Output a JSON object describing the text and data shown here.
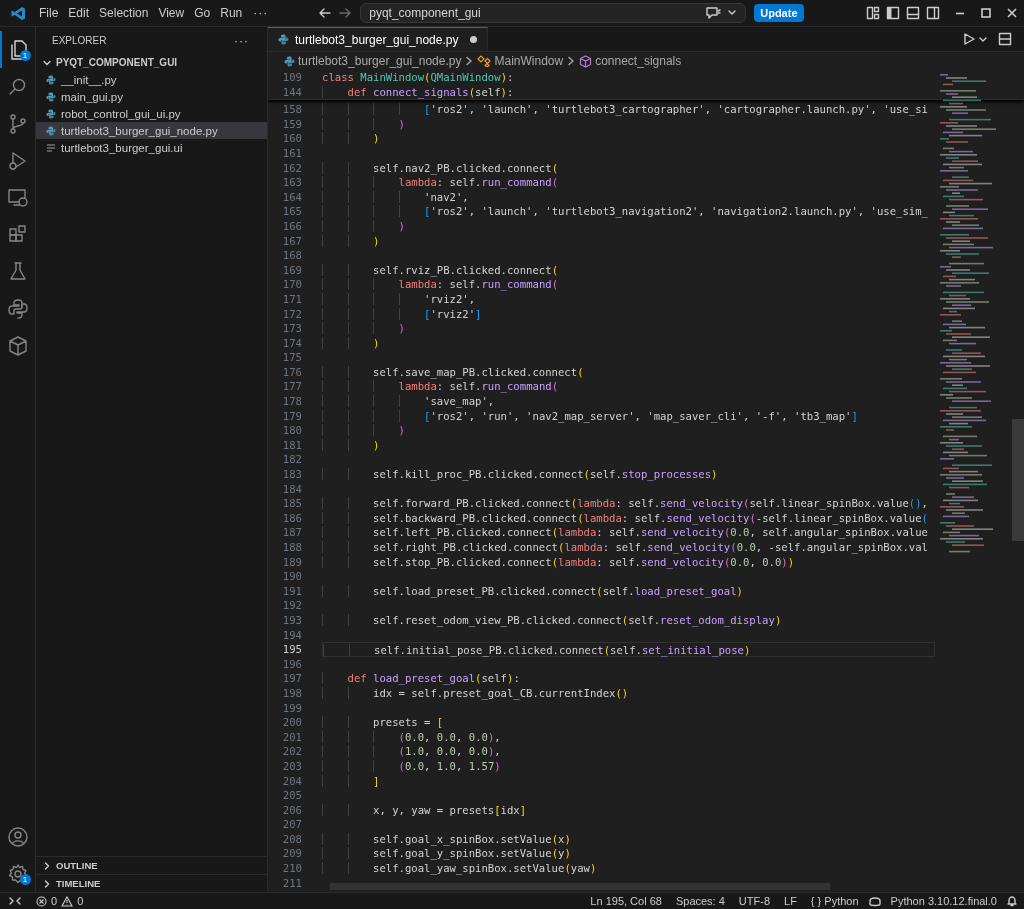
{
  "title_bar": {
    "menus": [
      "File",
      "Edit",
      "Selection",
      "View",
      "Go",
      "Run"
    ],
    "overflow": "···",
    "search": "pyqt_component_gui",
    "update_button": "Update"
  },
  "activity_bar": {
    "items": [
      {
        "kind": "explorer",
        "selected": true,
        "badge": "1"
      },
      {
        "kind": "search",
        "selected": false
      },
      {
        "kind": "source-control",
        "selected": false
      },
      {
        "kind": "run-debug",
        "selected": false
      },
      {
        "kind": "remote",
        "selected": false
      },
      {
        "kind": "extensions",
        "selected": false
      },
      {
        "kind": "testing",
        "selected": false
      },
      {
        "kind": "python",
        "selected": false
      },
      {
        "kind": "containers",
        "selected": false
      }
    ],
    "bottom": [
      {
        "kind": "account"
      },
      {
        "kind": "settings",
        "badge": "1"
      }
    ]
  },
  "sidebar": {
    "title": "EXPLORER",
    "more": "···",
    "folder": {
      "name": "PYQT_COMPONENT_GUI",
      "expanded": true,
      "children": [
        {
          "name": "__init__.py",
          "kind": "python",
          "selected": false
        },
        {
          "name": "main_gui.py",
          "kind": "python",
          "selected": false
        },
        {
          "name": "robot_control_gui_ui.py",
          "kind": "python",
          "selected": false
        },
        {
          "name": "turtlebot3_burger_gui_node.py",
          "kind": "python",
          "selected": true
        },
        {
          "name": "turtlebot3_burger_gui.ui",
          "kind": "text",
          "selected": false
        }
      ]
    },
    "sections": [
      {
        "name": "OUTLINE",
        "expanded": false
      },
      {
        "name": "TIMELINE",
        "expanded": false
      }
    ]
  },
  "editor": {
    "tabs": [
      {
        "label": "turtlebot3_burger_gui_node.py",
        "selected": true,
        "modified": true
      }
    ],
    "breadcrumbs": [
      {
        "label": "turtlebot3_burger_gui_node.py",
        "kind": "file"
      },
      {
        "label": "MainWindow",
        "kind": "class"
      },
      {
        "label": "connect_signals",
        "kind": "method"
      }
    ],
    "sticky_lines": [
      {
        "number": "109",
        "segments": [
          {
            "text": "class ",
            "kind": "keyword"
          },
          {
            "text": "MainWindow",
            "kind": "type"
          },
          {
            "text": "(",
            "kind": "bracket1"
          },
          {
            "text": "QMainWindow",
            "kind": "type"
          },
          {
            "text": ")",
            "kind": "bracket1"
          },
          {
            "text": ":",
            "kind": "plain"
          }
        ]
      },
      {
        "number": "144",
        "segments": [
          {
            "text": "    def ",
            "kind": "keyword"
          },
          {
            "text": "connect_signals",
            "kind": "function"
          },
          {
            "text": "(",
            "kind": "bracket1"
          },
          {
            "text": "self",
            "kind": "plain"
          },
          {
            "text": ")",
            "kind": "bracket1"
          },
          {
            "text": ":",
            "kind": "plain"
          }
        ]
      }
    ],
    "lines": [
      {
        "number": "158",
        "current": false,
        "segments": [
          {
            "text": "                [",
            "kind": "bracket3"
          },
          {
            "text": "'ros2', 'launch', 'turtlebot3_cartographer', 'cartographer.launch.py', 'use_si",
            "kind": "plain"
          }
        ]
      },
      {
        "number": "159",
        "current": false,
        "segments": [
          {
            "text": "            )",
            "kind": "bracket2"
          }
        ]
      },
      {
        "number": "160",
        "current": false,
        "segments": [
          {
            "text": "        )",
            "kind": "bracket1"
          }
        ]
      },
      {
        "number": "161",
        "current": false
      },
      {
        "number": "162",
        "current": false,
        "segments": [
          {
            "text": "        self.nav2_PB.clicked.connect",
            "kind": "plain"
          },
          {
            "text": "(",
            "kind": "bracket1"
          }
        ]
      },
      {
        "number": "163",
        "current": false,
        "segments": [
          {
            "text": "            lambda",
            "kind": "keyword"
          },
          {
            "text": ": self.",
            "kind": "plain"
          },
          {
            "text": "run_command",
            "kind": "function"
          },
          {
            "text": "(",
            "kind": "bracket2"
          }
        ]
      },
      {
        "number": "164",
        "current": false,
        "segments": [
          {
            "text": "                'nav2',",
            "kind": "plain"
          }
        ]
      },
      {
        "number": "165",
        "current": false,
        "segments": [
          {
            "text": "                [",
            "kind": "bracket3"
          },
          {
            "text": "'ros2', 'launch', 'turtlebot3_navigation2', 'navigation2.launch.py', 'use_sim_",
            "kind": "plain"
          }
        ]
      },
      {
        "number": "166",
        "current": false,
        "segments": [
          {
            "text": "            )",
            "kind": "bracket2"
          }
        ]
      },
      {
        "number": "167",
        "current": false,
        "segments": [
          {
            "text": "        )",
            "kind": "bracket1"
          }
        ]
      },
      {
        "number": "168",
        "current": false
      },
      {
        "number": "169",
        "current": false,
        "segments": [
          {
            "text": "        self.rviz_PB.clicked.connect",
            "kind": "plain"
          },
          {
            "text": "(",
            "kind": "bracket1"
          }
        ]
      },
      {
        "number": "170",
        "current": false,
        "segments": [
          {
            "text": "            lambda",
            "kind": "keyword"
          },
          {
            "text": ": self.",
            "kind": "plain"
          },
          {
            "text": "run_command",
            "kind": "function"
          },
          {
            "text": "(",
            "kind": "bracket2"
          }
        ]
      },
      {
        "number": "171",
        "current": false,
        "segments": [
          {
            "text": "                'rviz2',",
            "kind": "plain"
          }
        ]
      },
      {
        "number": "172",
        "current": false,
        "segments": [
          {
            "text": "                [",
            "kind": "bracket3"
          },
          {
            "text": "'rviz2'",
            "kind": "plain"
          },
          {
            "text": "]",
            "kind": "bracket3"
          }
        ]
      },
      {
        "number": "173",
        "current": false,
        "segments": [
          {
            "text": "            )",
            "kind": "bracket2"
          }
        ]
      },
      {
        "number": "174",
        "current": false,
        "segments": [
          {
            "text": "        )",
            "kind": "bracket1"
          }
        ]
      },
      {
        "number": "175",
        "current": false
      },
      {
        "number": "176",
        "current": false,
        "segments": [
          {
            "text": "        self.save_map_PB.clicked.connect",
            "kind": "plain"
          },
          {
            "text": "(",
            "kind": "bracket1"
          }
        ]
      },
      {
        "number": "177",
        "current": false,
        "segments": [
          {
            "text": "            lambda",
            "kind": "keyword"
          },
          {
            "text": ": self.",
            "kind": "plain"
          },
          {
            "text": "run_command",
            "kind": "function"
          },
          {
            "text": "(",
            "kind": "bracket2"
          }
        ]
      },
      {
        "number": "178",
        "current": false,
        "segments": [
          {
            "text": "                'save_map',",
            "kind": "plain"
          }
        ]
      },
      {
        "number": "179",
        "current": false,
        "segments": [
          {
            "text": "                [",
            "kind": "bracket3"
          },
          {
            "text": "'ros2', 'run', 'nav2_map_server', 'map_saver_cli', '-f', 'tb3_map'",
            "kind": "plain"
          },
          {
            "text": "]",
            "kind": "bracket3"
          }
        ]
      },
      {
        "number": "180",
        "current": false,
        "segments": [
          {
            "text": "            )",
            "kind": "bracket2"
          }
        ]
      },
      {
        "number": "181",
        "current": false,
        "segments": [
          {
            "text": "        )",
            "kind": "bracket1"
          }
        ]
      },
      {
        "number": "182",
        "current": false
      },
      {
        "number": "183",
        "current": false,
        "segments": [
          {
            "text": "        self.kill_proc_PB.clicked.connect",
            "kind": "plain"
          },
          {
            "text": "(",
            "kind": "bracket1"
          },
          {
            "text": "self.",
            "kind": "plain"
          },
          {
            "text": "stop_processes",
            "kind": "function"
          },
          {
            "text": ")",
            "kind": "bracket1"
          }
        ]
      },
      {
        "number": "184",
        "current": false
      },
      {
        "number": "185",
        "current": false,
        "segments": [
          {
            "text": "        self.forward_PB.clicked.connect",
            "kind": "plain"
          },
          {
            "text": "(",
            "kind": "bracket1"
          },
          {
            "text": "lambda",
            "kind": "keyword"
          },
          {
            "text": ": self.",
            "kind": "plain"
          },
          {
            "text": "send_velocity",
            "kind": "function"
          },
          {
            "text": "(",
            "kind": "bracket2"
          },
          {
            "text": "self.linear_spinBox.value",
            "kind": "plain"
          },
          {
            "text": "()",
            "kind": "bracket3"
          },
          {
            "text": ",",
            "kind": "plain"
          }
        ]
      },
      {
        "number": "186",
        "current": false,
        "segments": [
          {
            "text": "        self.backward_PB.clicked.connect",
            "kind": "plain"
          },
          {
            "text": "(",
            "kind": "bracket1"
          },
          {
            "text": "lambda",
            "kind": "keyword"
          },
          {
            "text": ": self.",
            "kind": "plain"
          },
          {
            "text": "send_velocity",
            "kind": "function"
          },
          {
            "text": "(",
            "kind": "bracket2"
          },
          {
            "text": "-self.linear_spinBox.value",
            "kind": "plain"
          },
          {
            "text": "(",
            "kind": "bracket3"
          }
        ]
      },
      {
        "number": "187",
        "current": false,
        "segments": [
          {
            "text": "        self.left_PB.clicked.connect",
            "kind": "plain"
          },
          {
            "text": "(",
            "kind": "bracket1"
          },
          {
            "text": "lambda",
            "kind": "keyword"
          },
          {
            "text": ": self.",
            "kind": "plain"
          },
          {
            "text": "send_velocity",
            "kind": "function"
          },
          {
            "text": "(",
            "kind": "bracket2"
          },
          {
            "text": "0.0",
            "kind": "number"
          },
          {
            "text": ", self.angular_spinBox.value",
            "kind": "plain"
          }
        ]
      },
      {
        "number": "188",
        "current": false,
        "segments": [
          {
            "text": "        self.right_PB.clicked.connect",
            "kind": "plain"
          },
          {
            "text": "(",
            "kind": "bracket1"
          },
          {
            "text": "lambda",
            "kind": "keyword"
          },
          {
            "text": ": self.",
            "kind": "plain"
          },
          {
            "text": "send_velocity",
            "kind": "function"
          },
          {
            "text": "(",
            "kind": "bracket2"
          },
          {
            "text": "0.0",
            "kind": "number"
          },
          {
            "text": ", -self.angular_spinBox.val",
            "kind": "plain"
          }
        ]
      },
      {
        "number": "189",
        "current": false,
        "segments": [
          {
            "text": "        self.stop_PB.clicked.connect",
            "kind": "plain"
          },
          {
            "text": "(",
            "kind": "bracket1"
          },
          {
            "text": "lambda",
            "kind": "keyword"
          },
          {
            "text": ": self.",
            "kind": "plain"
          },
          {
            "text": "send_velocity",
            "kind": "function"
          },
          {
            "text": "(",
            "kind": "bracket2"
          },
          {
            "text": "0.0",
            "kind": "number"
          },
          {
            "text": ", ",
            "kind": "plain"
          },
          {
            "text": "0.0",
            "kind": "number"
          },
          {
            "text": ")",
            "kind": "bracket2"
          },
          {
            "text": ")",
            "kind": "bracket1"
          }
        ]
      },
      {
        "number": "190",
        "current": false
      },
      {
        "number": "191",
        "current": false,
        "segments": [
          {
            "text": "        self.load_preset_PB.clicked.connect",
            "kind": "plain"
          },
          {
            "text": "(",
            "kind": "bracket1"
          },
          {
            "text": "self.",
            "kind": "plain"
          },
          {
            "text": "load_preset_goal",
            "kind": "function"
          },
          {
            "text": ")",
            "kind": "bracket1"
          }
        ]
      },
      {
        "number": "192",
        "current": false
      },
      {
        "number": "193",
        "current": false,
        "segments": [
          {
            "text": "        self.reset_odom_view_PB.clicked.connect",
            "kind": "plain"
          },
          {
            "text": "(",
            "kind": "bracket1"
          },
          {
            "text": "self.",
            "kind": "plain"
          },
          {
            "text": "reset_odom_display",
            "kind": "function"
          },
          {
            "text": ")",
            "kind": "bracket1"
          }
        ]
      },
      {
        "number": "194",
        "current": false
      },
      {
        "number": "195",
        "current": true,
        "segments": [
          {
            "text": "        self.initial_pose_PB.clicked.connect",
            "kind": "plain"
          },
          {
            "text": "(",
            "kind": "bracket1"
          },
          {
            "text": "self.",
            "kind": "plain"
          },
          {
            "text": "set_initial_pose",
            "kind": "function"
          },
          {
            "text": ")",
            "kind": "bracket1"
          }
        ]
      },
      {
        "number": "196",
        "current": false
      },
      {
        "number": "197",
        "current": false,
        "segments": [
          {
            "text": "    def ",
            "kind": "keyword"
          },
          {
            "text": "load_preset_goal",
            "kind": "function"
          },
          {
            "text": "(",
            "kind": "bracket1"
          },
          {
            "text": "self",
            "kind": "plain"
          },
          {
            "text": ")",
            "kind": "bracket1"
          },
          {
            "text": ":",
            "kind": "plain"
          }
        ]
      },
      {
        "number": "198",
        "current": false,
        "segments": [
          {
            "text": "        idx = self.preset_goal_CB.currentIndex",
            "kind": "plain"
          },
          {
            "text": "()",
            "kind": "bracket1"
          }
        ]
      },
      {
        "number": "199",
        "current": false
      },
      {
        "number": "200",
        "current": false,
        "segments": [
          {
            "text": "        presets = ",
            "kind": "plain"
          },
          {
            "text": "[",
            "kind": "bracket1"
          }
        ]
      },
      {
        "number": "201",
        "current": false,
        "segments": [
          {
            "text": "            (",
            "kind": "bracket2"
          },
          {
            "text": "0.0",
            "kind": "number"
          },
          {
            "text": ", ",
            "kind": "plain"
          },
          {
            "text": "0.0",
            "kind": "number"
          },
          {
            "text": ", ",
            "kind": "plain"
          },
          {
            "text": "0.0",
            "kind": "number"
          },
          {
            "text": ")",
            "kind": "bracket2"
          },
          {
            "text": ",",
            "kind": "plain"
          }
        ]
      },
      {
        "number": "202",
        "current": false,
        "segments": [
          {
            "text": "            (",
            "kind": "bracket2"
          },
          {
            "text": "1.0",
            "kind": "number"
          },
          {
            "text": ", ",
            "kind": "plain"
          },
          {
            "text": "0.0",
            "kind": "number"
          },
          {
            "text": ", ",
            "kind": "plain"
          },
          {
            "text": "0.0",
            "kind": "number"
          },
          {
            "text": ")",
            "kind": "bracket2"
          },
          {
            "text": ",",
            "kind": "plain"
          }
        ]
      },
      {
        "number": "203",
        "current": false,
        "segments": [
          {
            "text": "            (",
            "kind": "bracket2"
          },
          {
            "text": "0.0",
            "kind": "number"
          },
          {
            "text": ", ",
            "kind": "plain"
          },
          {
            "text": "1.0",
            "kind": "number"
          },
          {
            "text": ", ",
            "kind": "plain"
          },
          {
            "text": "1.57",
            "kind": "number"
          },
          {
            "text": ")",
            "kind": "bracket2"
          }
        ]
      },
      {
        "number": "204",
        "current": false,
        "segments": [
          {
            "text": "        ]",
            "kind": "bracket1"
          }
        ]
      },
      {
        "number": "205",
        "current": false
      },
      {
        "number": "206",
        "current": false,
        "segments": [
          {
            "text": "        x, y, yaw = presets",
            "kind": "plain"
          },
          {
            "text": "[",
            "kind": "bracket1"
          },
          {
            "text": "idx",
            "kind": "plain"
          },
          {
            "text": "]",
            "kind": "bracket1"
          }
        ]
      },
      {
        "number": "207",
        "current": false
      },
      {
        "number": "208",
        "current": false,
        "segments": [
          {
            "text": "        self.goal_x_spinBox.setValue",
            "kind": "plain"
          },
          {
            "text": "(",
            "kind": "bracket1"
          },
          {
            "text": "x",
            "kind": "plain"
          },
          {
            "text": ")",
            "kind": "bracket1"
          }
        ]
      },
      {
        "number": "209",
        "current": false,
        "segments": [
          {
            "text": "        self.goal_y_spinBox.setValue",
            "kind": "plain"
          },
          {
            "text": "(",
            "kind": "bracket1"
          },
          {
            "text": "y",
            "kind": "plain"
          },
          {
            "text": ")",
            "kind": "bracket1"
          }
        ]
      },
      {
        "number": "210",
        "current": false,
        "segments": [
          {
            "text": "        self.goal_yaw_spinBox.setValue",
            "kind": "plain"
          },
          {
            "text": "(",
            "kind": "bracket1"
          },
          {
            "text": "yaw",
            "kind": "plain"
          },
          {
            "text": ")",
            "kind": "bracket1"
          }
        ]
      },
      {
        "number": "211",
        "current": false
      }
    ]
  },
  "status_bar": {
    "errors": "0",
    "warnings": "0",
    "items": [
      "Ln 195, Col 68",
      "Spaces: 4",
      "UTF-8",
      "LF",
      "{ } Python"
    ],
    "interpreter": "Python 3.10.12.final.0"
  }
}
